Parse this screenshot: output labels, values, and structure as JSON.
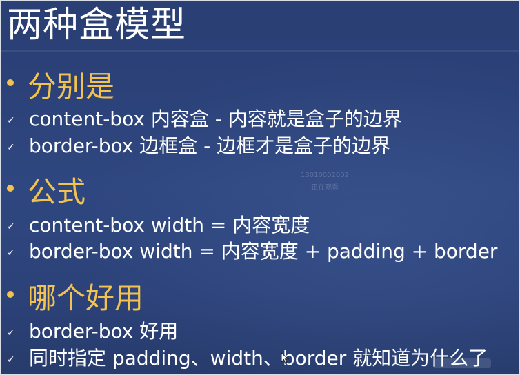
{
  "slide": {
    "title": "两种盒模型",
    "sections": [
      {
        "heading": "分别是",
        "items": [
          "content-box 内容盒 - 内容就是盒子的边界",
          "border-box 边框盒 - 边框才是盒子的边界"
        ]
      },
      {
        "heading": "公式",
        "items": [
          "content-box width = 内容宽度",
          "border-box width = 内容宽度 + padding + border"
        ]
      },
      {
        "heading": "哪个好用",
        "items": [
          "border-box 好用",
          "同时指定 padding、width、border 就知道为什么了"
        ]
      }
    ],
    "watermark": {
      "line1": "13010002002",
      "line2": "正在观看"
    }
  },
  "icons": {
    "bullet": "bullet-dot-icon",
    "check": "check-mark-icon",
    "cursor": "mouse-cursor-icon"
  },
  "colors": {
    "background": "#2c4279",
    "heading": "#f2c350",
    "text": "#ffffff"
  }
}
